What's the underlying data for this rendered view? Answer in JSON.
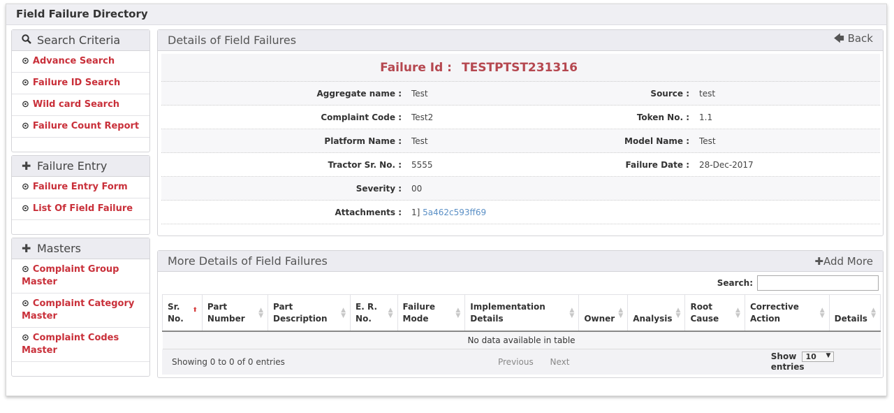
{
  "page": {
    "title": "Field Failure Directory"
  },
  "sidebar": {
    "search_panel": {
      "title": "Search Criteria",
      "items": [
        "Advance Search",
        "Failure ID Search",
        "Wild card Search",
        "Failure Count Report"
      ]
    },
    "entry_panel": {
      "title": "Failure Entry",
      "items": [
        "Failure Entry Form",
        "List Of Field Failure"
      ]
    },
    "masters_panel": {
      "title": "Masters",
      "items": [
        "Complaint Group Master",
        "Complaint Category Master",
        "Complaint Codes Master"
      ]
    }
  },
  "details": {
    "title": "Details of Field Failures",
    "back_label": "Back",
    "failure_id_label": "Failure Id :",
    "failure_id": "TESTPTST231316",
    "aggregate_label": "Aggregate name :",
    "aggregate": "Test",
    "source_label": "Source :",
    "source": "test",
    "complaint_code_label": "Complaint Code :",
    "complaint_code": "Test2",
    "token_label": "Token No. :",
    "token": "1.1",
    "platform_label": "Platform Name :",
    "platform": "Test",
    "model_label": "Model Name :",
    "model": "Test",
    "tractor_label": "Tractor Sr. No. :",
    "tractor": "5555",
    "failure_date_label": "Failure Date :",
    "failure_date": "28-Dec-2017",
    "severity_label": "Severity :",
    "severity": "00",
    "attachments_label": "Attachments :",
    "attachment_index": "1]",
    "attachment_link": "5a462c593ff69"
  },
  "more": {
    "title": "More Details of Field Failures",
    "add_label": "Add More",
    "search_label": "Search:",
    "columns": [
      [
        "Sr.",
        "No."
      ],
      [
        "Part",
        "Number"
      ],
      [
        "Part",
        "Description"
      ],
      [
        "E. R.",
        "No."
      ],
      [
        "Failure",
        "Mode"
      ],
      [
        "Implementation",
        "Details"
      ],
      [
        "",
        "Owner"
      ],
      [
        "",
        "Analysis"
      ],
      [
        "Root",
        "Cause"
      ],
      [
        "Corrective",
        "Action"
      ],
      [
        "",
        "Details"
      ]
    ],
    "empty_text": "No data available in table",
    "info_text": "Showing 0 to 0 of 0 entries",
    "prev_label": "Previous",
    "next_label": "Next",
    "show_label": "Show",
    "page_size": "10",
    "entries_label": "entries"
  },
  "colors": {
    "accent_red": "#c9303a",
    "failure_id": "#b5474f",
    "link": "#5a8fc5"
  }
}
